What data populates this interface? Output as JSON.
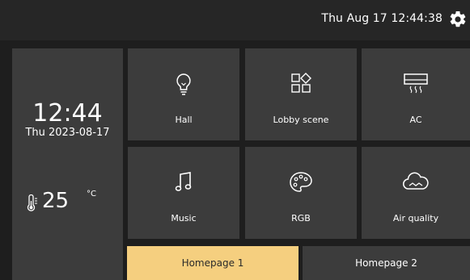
{
  "topbar": {
    "datetime": "Thu Aug 17  12:44:38",
    "settings_icon": "gear-icon"
  },
  "clock": {
    "time": "12:44",
    "date": "Thu 2023-08-17"
  },
  "weather": {
    "temperature": "25",
    "unit": "°C",
    "icon": "thermometer-icon"
  },
  "tiles": [
    {
      "label": "Hall",
      "icon": "lightbulb-icon"
    },
    {
      "label": "Lobby scene",
      "icon": "scene-icon"
    },
    {
      "label": "AC",
      "icon": "air-conditioner-icon"
    },
    {
      "label": "Music",
      "icon": "music-note-icon"
    },
    {
      "label": "RGB",
      "icon": "palette-icon"
    },
    {
      "label": "Air quality",
      "icon": "air-quality-cloud-icon"
    }
  ],
  "tabs": [
    {
      "label": "Homepage 1",
      "active": true
    },
    {
      "label": "Homepage 2",
      "active": false
    }
  ],
  "colors": {
    "background": "#1e1e1e",
    "tile": "#3c3c3c",
    "topbar": "#262626",
    "active_tab": "#f5cf7f"
  }
}
